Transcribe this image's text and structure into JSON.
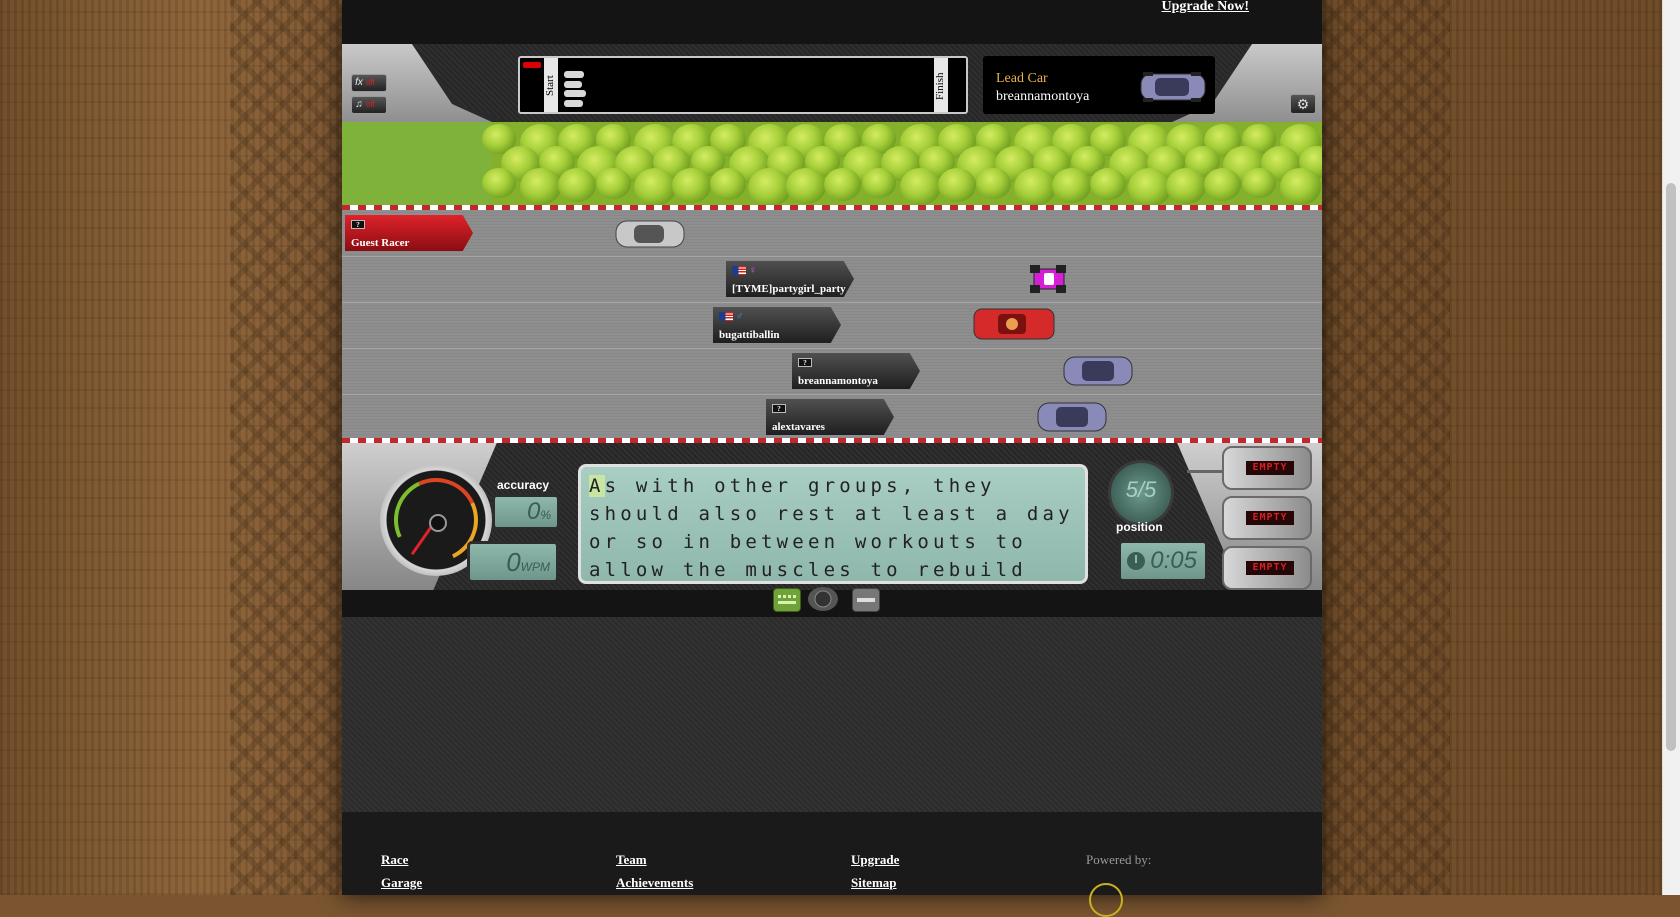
{
  "header": {
    "upgrade_link": "Upgrade Now!"
  },
  "controls": {
    "fx": {
      "icon": "fx-icon",
      "label": "fx",
      "state": "off"
    },
    "music": {
      "icon": "music-note-icon",
      "label": "♫",
      "state": "off"
    },
    "settings": {
      "icon": "gear-icon",
      "label": "⚙"
    }
  },
  "progress": {
    "start_label": "Start",
    "finish_label": "Finish"
  },
  "lead_car": {
    "label": "Lead Car",
    "name": "breannamontoya"
  },
  "racers": [
    {
      "name": "Guest Racer",
      "flag": "unknown",
      "car_color": "#c8c8c8",
      "is_user": true
    },
    {
      "name": "[TYME]partygirl_party",
      "flag": "us",
      "gender": "female",
      "car_color": "#d41fd4"
    },
    {
      "name": "bugattiballin",
      "flag": "us",
      "gender": "male",
      "car_color": "#d42a2a"
    },
    {
      "name": "breannamontoya",
      "flag": "unknown",
      "car_color": "#8a8ab8"
    },
    {
      "name": "alextavares",
      "flag": "unknown",
      "car_color": "#8a8ab8"
    }
  ],
  "stats": {
    "accuracy_label": "accuracy",
    "accuracy_value": "0",
    "accuracy_unit": "%",
    "wpm_value": "0",
    "wpm_unit": "WPM",
    "position_value": "5/5",
    "position_label": "position",
    "timer": "0:05"
  },
  "typing": {
    "cursor_char": "A",
    "text": "s with other groups, they should also rest at least a day or so in between workouts to allow the muscles to rebuild and add to the"
  },
  "nitros": [
    "EMPTY",
    "EMPTY",
    "EMPTY"
  ],
  "footer": {
    "links_col1": [
      "Race",
      "Garage"
    ],
    "links_col2": [
      "Team",
      "Achievements"
    ],
    "links_col3": [
      "Upgrade",
      "Sitemap"
    ],
    "powered_by": "Powered by:"
  }
}
